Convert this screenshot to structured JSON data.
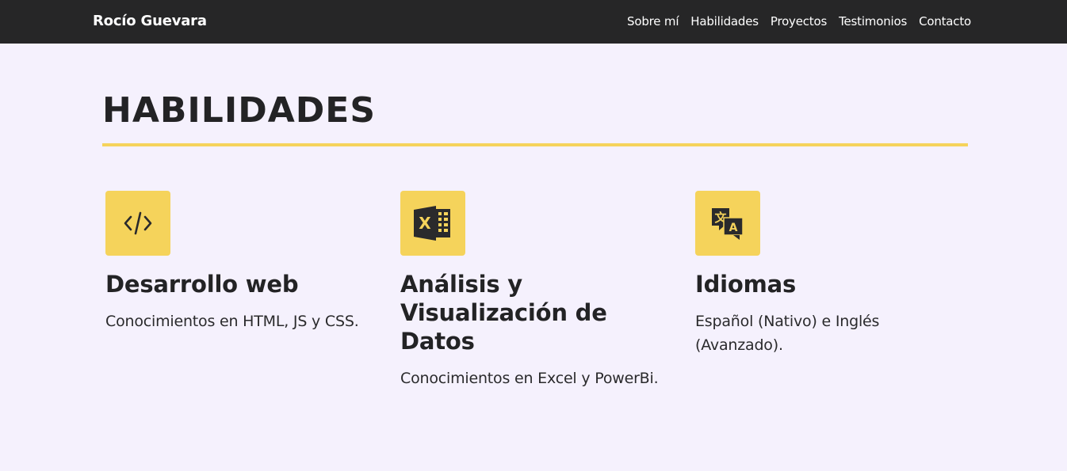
{
  "nav": {
    "brand": "Rocío Guevara",
    "links": [
      "Sobre mí",
      "Habilidades",
      "Proyectos",
      "Testimonios",
      "Contacto"
    ]
  },
  "section": {
    "title": "HABILIDADES"
  },
  "skills": [
    {
      "icon": "code-icon",
      "title": "Desarrollo web",
      "description": "Conocimientos en HTML, JS y CSS."
    },
    {
      "icon": "excel-icon",
      "title": "Análisis y Visualización de Datos",
      "description": "Conocimientos en Excel y PowerBi."
    },
    {
      "icon": "translate-icon",
      "title": "Idiomas",
      "description": "Español (Nativo) e Inglés (Avanzado)."
    }
  ],
  "colors": {
    "navbar": "#262627",
    "background": "#f5f1fd",
    "accent": "#f5d35b",
    "text": "#232325"
  }
}
